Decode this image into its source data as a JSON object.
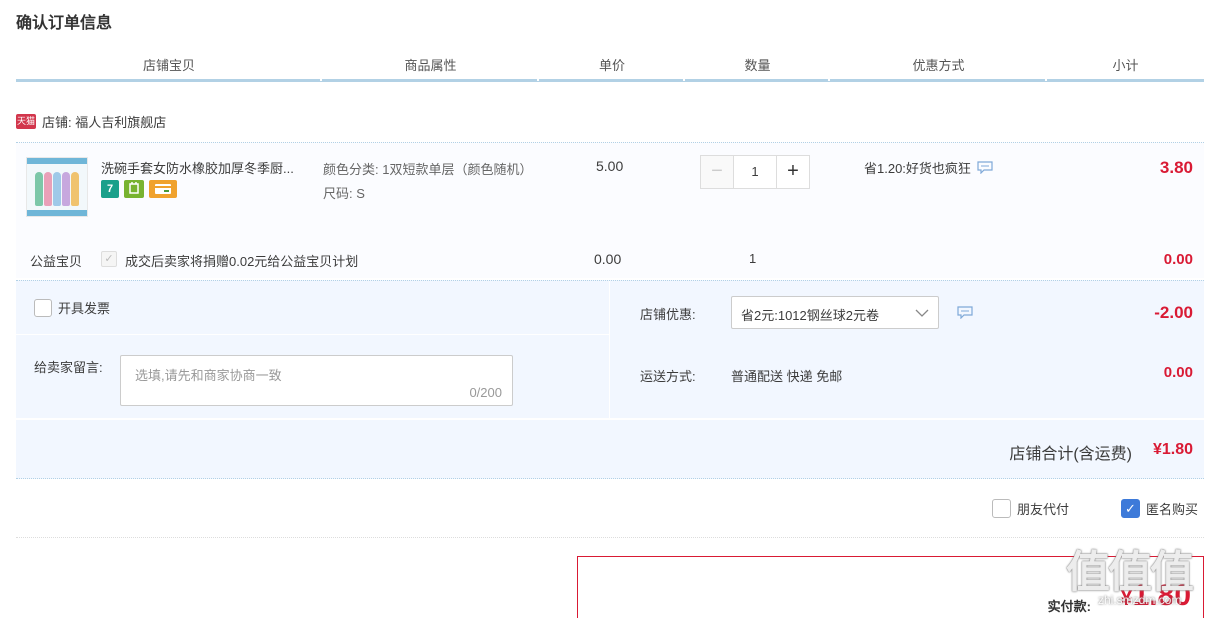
{
  "page_title": "确认订单信息",
  "columns": [
    "店铺宝贝",
    "商品属性",
    "单价",
    "数量",
    "优惠方式",
    "小计"
  ],
  "shop": {
    "badge": "天猫",
    "label": "店铺: 福人吉利旗舰店"
  },
  "item": {
    "title": "洗碗手套女防水橡胶加厚冬季厨...",
    "badge_7": "7",
    "attr_color": "颜色分类: 1双短款单层（颜色随机）",
    "attr_size": "尺码: S",
    "price": "5.00",
    "quantity": "1",
    "minus": "−",
    "plus": "+",
    "promo": "省1.20:好货也疯狂",
    "subtotal": "3.80"
  },
  "charity": {
    "label": "公益宝贝",
    "check": "✓",
    "text": "成交后卖家将捐赠0.02元给公益宝贝计划",
    "price": "0.00",
    "quantity": "1",
    "subtotal": "0.00"
  },
  "invoice": {
    "label": "开具发票"
  },
  "message": {
    "label": "给卖家留言:",
    "placeholder": "选填,请先和商家协商一致",
    "count": "0/200"
  },
  "shop_discount": {
    "label": "店铺优惠:",
    "selected": "省2元:1012钢丝球2元卷",
    "value": "-2.00"
  },
  "shipping": {
    "label": "运送方式:",
    "text": "普通配送 快递 免邮",
    "value": "0.00"
  },
  "shop_total": {
    "label": "店铺合计(含运费)",
    "value": "¥1.80"
  },
  "options": {
    "friend_pay": "朋友代付",
    "anonymous": "匿名购买",
    "anonymous_checked": true,
    "check": "✓"
  },
  "payment": {
    "label": "实付款:",
    "yen": "¥",
    "value": "1.80"
  },
  "watermark": {
    "main": "值值值",
    "sub": "zhi.smzdm.com"
  },
  "colors": {
    "accent_red": "#d91a34",
    "header_line": "#b2d1e5",
    "panel_bg": "#f2f7ff",
    "checkbox_blue": "#3d7ad9"
  }
}
